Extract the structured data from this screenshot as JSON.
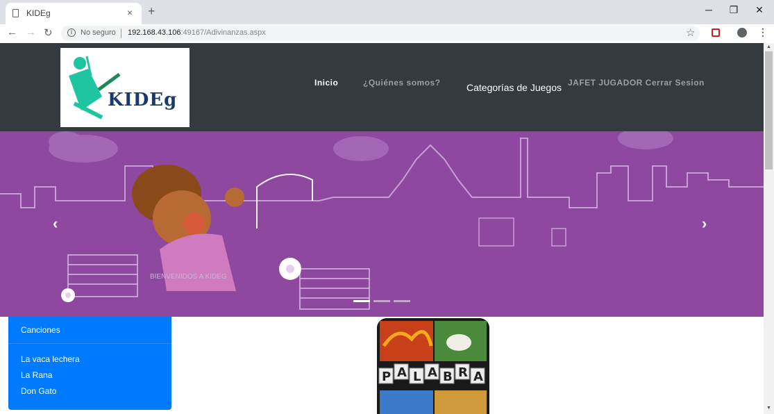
{
  "browser": {
    "tab_title": "KIDEg",
    "tab_close": "×",
    "new_tab": "+",
    "not_secure": "No seguro",
    "url_host": "192.168.43.106",
    "url_rest": ":49167/Adivinanzas.aspx"
  },
  "navbar": {
    "logo_text": "KIDEg",
    "links": [
      "Inicio",
      "¿Quiénes somos?",
      "Categorías de Juegos",
      "JAFET JUGADOR Cerrar Sesion"
    ]
  },
  "carousel": {
    "caption": "BIENVENIDOS A KIDEG",
    "prev": "‹",
    "next": "›",
    "active_slide": 1,
    "slide_count": 3
  },
  "sidebar": {
    "header": "Canciones",
    "items": [
      "La vaca lechera",
      "La Rana",
      "Don Gato"
    ]
  },
  "game": {
    "letters": [
      "P",
      "A",
      "L",
      "A",
      "B",
      "R",
      "A"
    ]
  },
  "colors": {
    "navbar_bg": "#343a40",
    "carousel_bg": "#8f48a0",
    "list_bg": "#007bff"
  }
}
